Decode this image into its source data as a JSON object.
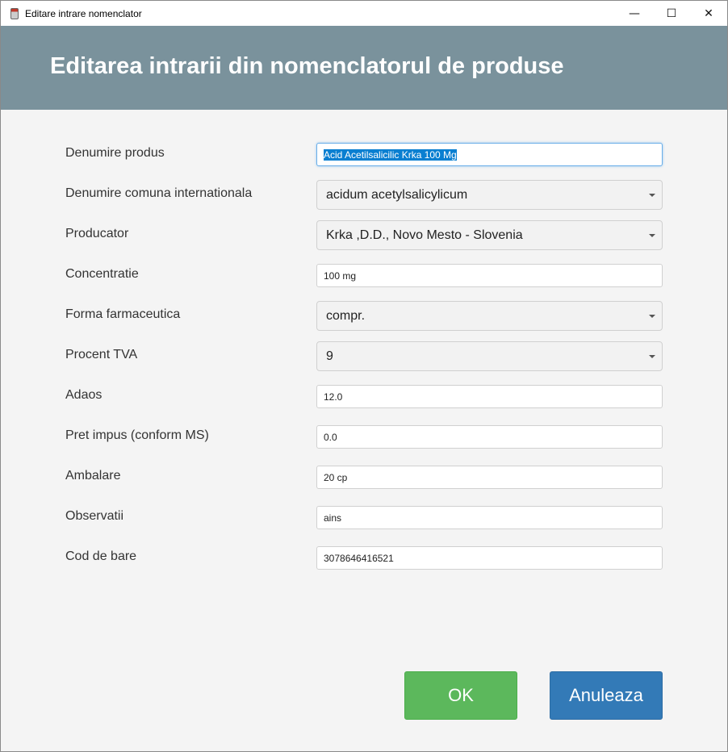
{
  "window": {
    "title": "Editare intrare nomenclator",
    "minimize": "—",
    "maximize": "☐",
    "close": "✕"
  },
  "header": {
    "title": "Editarea intrarii din nomenclatorul de produse"
  },
  "form": {
    "denumire": {
      "label": "Denumire produs",
      "value": "Acid Acetilsalicilic Krka 100 Mg"
    },
    "dci": {
      "label": "Denumire comuna internationala",
      "value": "acidum acetylsalicylicum"
    },
    "producator": {
      "label": "Producator",
      "value": "Krka ,D.D., Novo Mesto - Slovenia"
    },
    "concentratie": {
      "label": "Concentratie",
      "value": "100 mg"
    },
    "forma": {
      "label": "Forma farmaceutica",
      "value": "compr."
    },
    "tva": {
      "label": "Procent TVA",
      "value": "9"
    },
    "adaos": {
      "label": "Adaos",
      "value": "12.0"
    },
    "pret": {
      "label": "Pret impus (conform MS)",
      "value": "0.0"
    },
    "ambalare": {
      "label": "Ambalare",
      "value": "20 cp"
    },
    "observatii": {
      "label": "Observatii",
      "value": "ains"
    },
    "cod": {
      "label": "Cod de bare",
      "value": "3078646416521"
    }
  },
  "buttons": {
    "ok": "OK",
    "cancel": "Anuleaza"
  },
  "colors": {
    "header": "#7a929c",
    "ok": "#5cb85c",
    "cancel": "#337ab7"
  }
}
